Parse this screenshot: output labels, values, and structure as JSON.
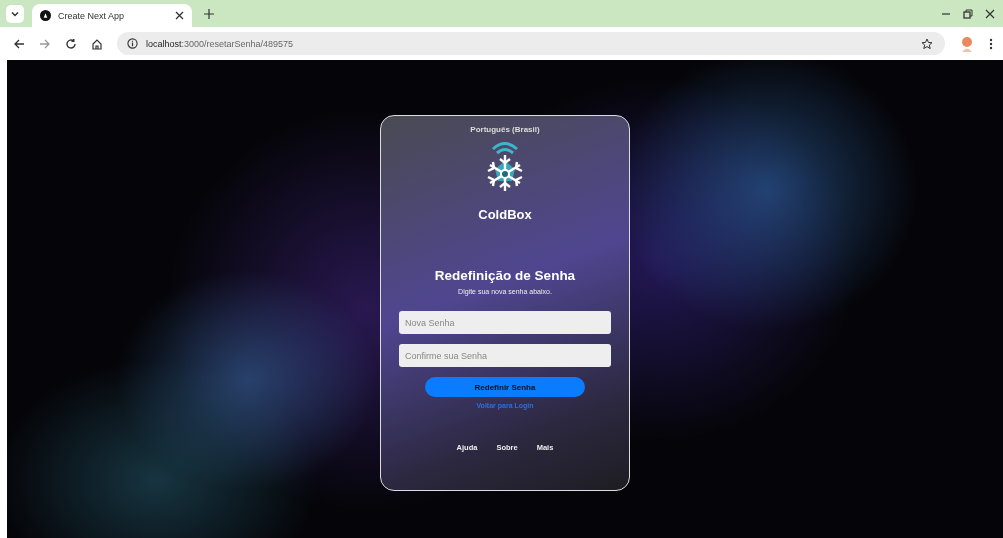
{
  "browser": {
    "tab_title": "Create Next App",
    "url_host": "localhost",
    "url_path": ":3000/resetarSenha/489575"
  },
  "card": {
    "language": "Português (Brasil)",
    "brand": "ColdBox",
    "heading": "Redefinição de Senha",
    "subheading": "Digite sua nova senha abaixo.",
    "fields": [
      {
        "placeholder": "Nova Senha"
      },
      {
        "placeholder": "Confirme sua Senha"
      }
    ],
    "submit": "Redefinir Senha",
    "back_link": "Voltar para Login",
    "footer_links": [
      "Ajuda",
      "Sobre",
      "Mais"
    ]
  }
}
